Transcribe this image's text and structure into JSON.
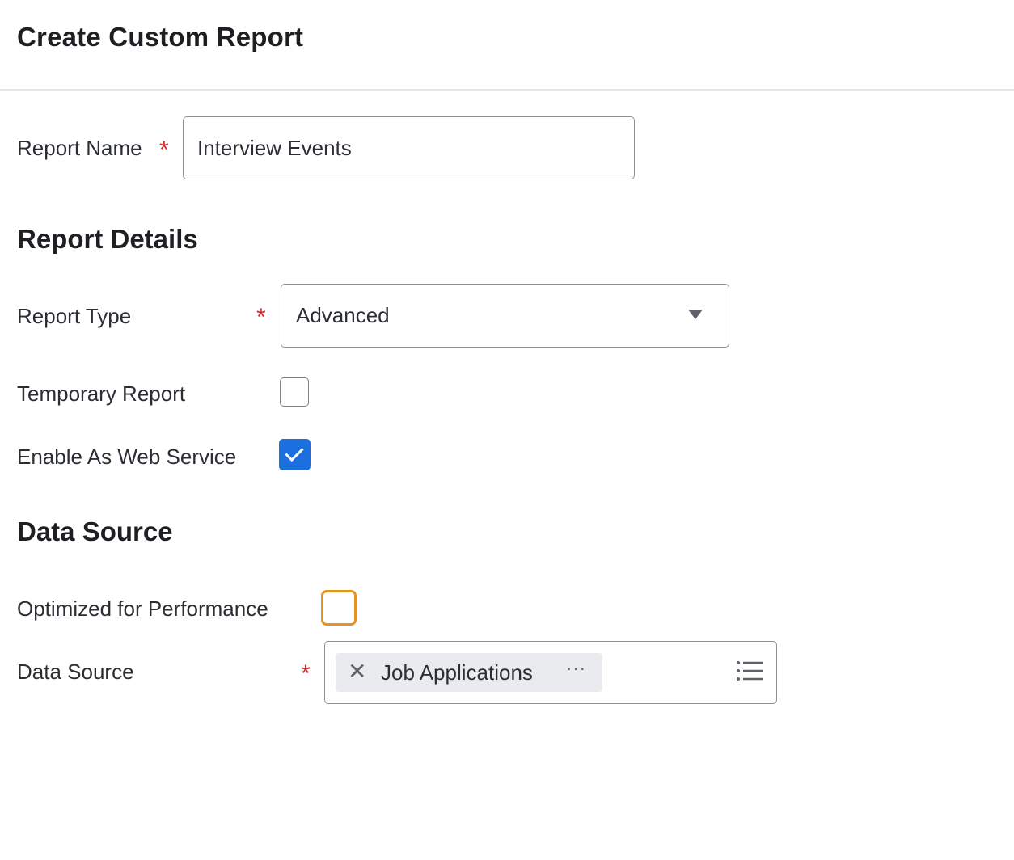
{
  "header": {
    "title": "Create Custom Report"
  },
  "report_name": {
    "label": "Report Name",
    "required_mark": "*",
    "value": "Interview Events"
  },
  "report_details": {
    "section_title": "Report Details",
    "report_type": {
      "label": "Report Type",
      "required_mark": "*",
      "selected": "Advanced"
    },
    "temporary_report": {
      "label": "Temporary Report",
      "checked": false
    },
    "enable_web_service": {
      "label": "Enable As Web Service",
      "checked": true
    }
  },
  "data_source": {
    "section_title": "Data Source",
    "optimized_for_performance": {
      "label": "Optimized for Performance",
      "checked": false,
      "focused": true
    },
    "source": {
      "label": "Data Source",
      "required_mark": "*",
      "selected_item": "Job Applications",
      "remove_glyph": "✕",
      "more_glyph": "···"
    }
  },
  "colors": {
    "required": "#d62b2b",
    "checkbox_checked": "#1b6fde",
    "focus_ring": "#e3951e",
    "border": "#8d9197"
  }
}
